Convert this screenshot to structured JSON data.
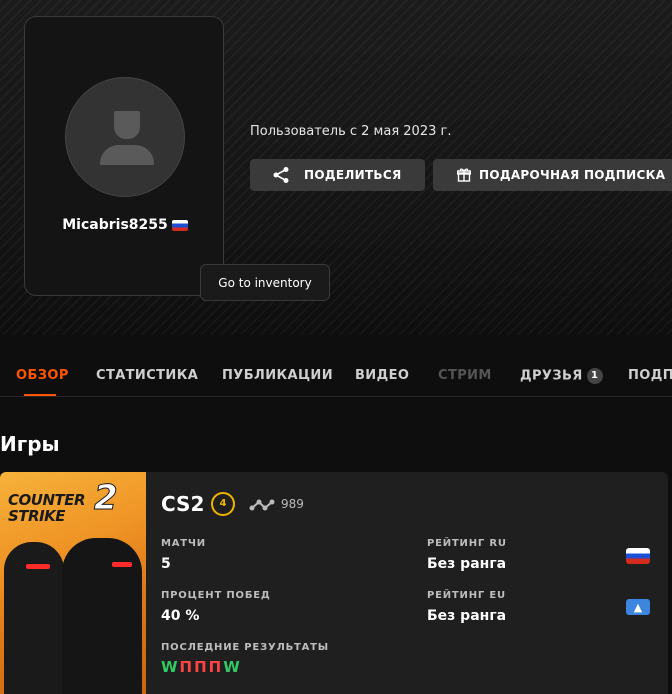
{
  "profile": {
    "username": "Micabris8255",
    "member_since": "Пользователь с 2 мая 2023 г.",
    "share_label": "ПОДЕЛИТЬСЯ",
    "gift_label": "ПОДАРОЧНАЯ ПОДПИСКА",
    "tooltip": "Go to inventory"
  },
  "tabs": [
    {
      "label": "ОБЗОР"
    },
    {
      "label": "СТАТИСТИКА"
    },
    {
      "label": "ПУБЛИКАЦИИ"
    },
    {
      "label": "ВИДЕО"
    },
    {
      "label": "СТРИМ"
    },
    {
      "label": "ДРУЗЬЯ",
      "badge": "1"
    },
    {
      "label": "ПОДП"
    }
  ],
  "games_section": {
    "title": "Игры"
  },
  "game": {
    "cover_title_line1": "COUNTER",
    "cover_title_line2": "STRIKE",
    "cover_number": "2",
    "name": "CS2",
    "level": "4",
    "elo": "989",
    "matches_label": "МАТЧИ",
    "matches_value": "5",
    "winrate_label": "ПРОЦЕНТ ПОБЕД",
    "winrate_value": "40 %",
    "rating_ru_label": "РЕЙТИНГ RU",
    "rating_ru_value": "Без ранга",
    "rating_eu_label": "РЕЙТИНГ EU",
    "rating_eu_value": "Без ранга",
    "recent_label": "ПОСЛЕДНИЕ РЕЗУЛЬТАТЫ",
    "recent_results": [
      "W",
      "П",
      "П",
      "П",
      "W"
    ]
  },
  "colors": {
    "accent": "#ff5500",
    "win": "#32c864",
    "loss": "#ff4242",
    "level_ring": "#f0b400"
  }
}
